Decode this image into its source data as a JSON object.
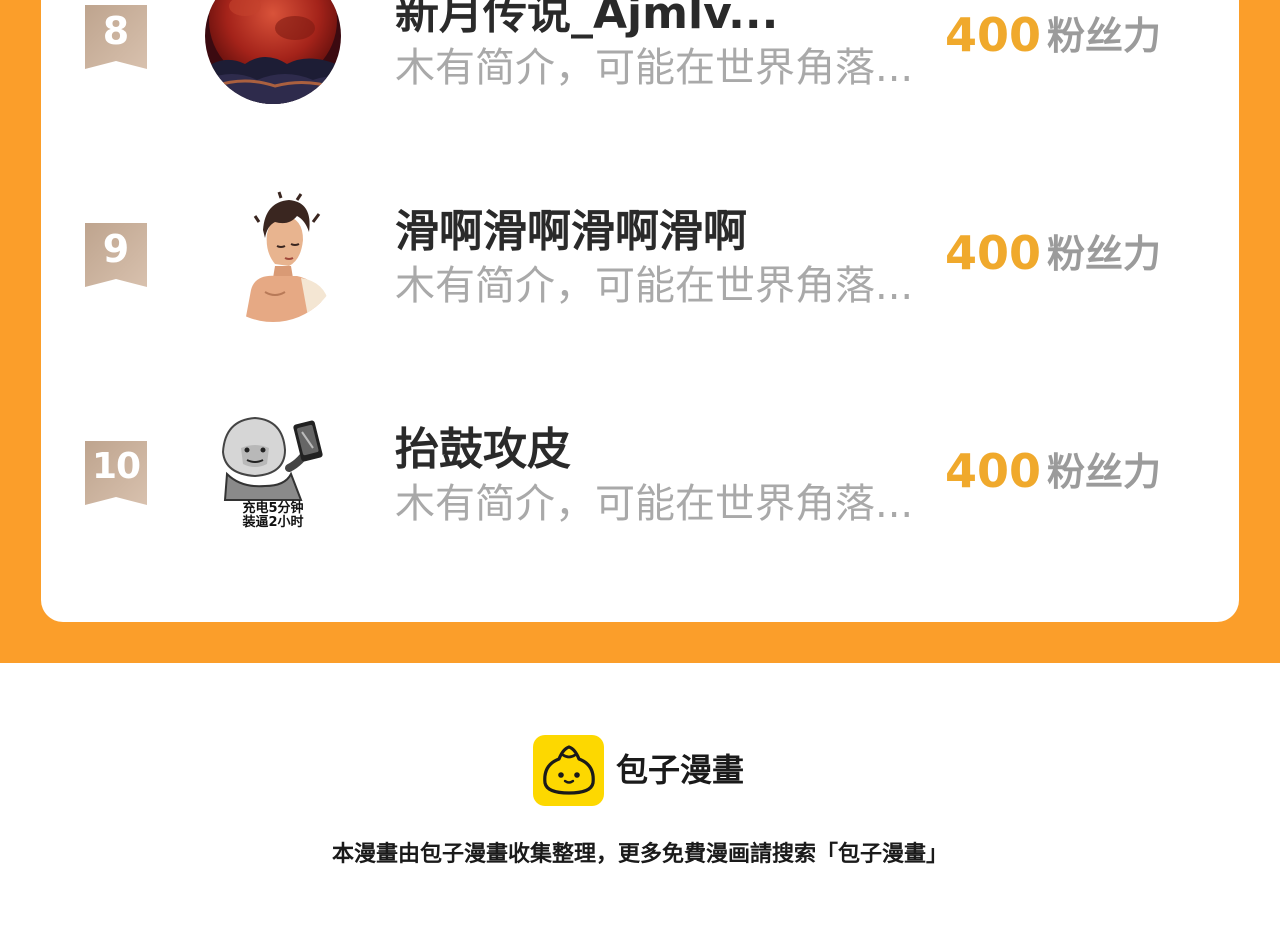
{
  "colors": {
    "accent_orange": "#fb9e2a",
    "fan_count": "#f0a92c",
    "rank_badge": "#c9ab95",
    "logo_yellow": "#fdd800"
  },
  "ranking": {
    "rows": [
      {
        "rank": "8",
        "name": "新月传说_Ajmlv...",
        "bio": "木有简介，可能在世界角落...",
        "fans": "400",
        "fans_unit": "粉丝力",
        "avatar": "blood-moon-avatar"
      },
      {
        "rank": "9",
        "name": "滑啊滑啊滑啊滑啊",
        "bio": "木有简介，可能在世界角落...",
        "fans": "400",
        "fans_unit": "粉丝力",
        "avatar": "anime-boy-avatar"
      },
      {
        "rank": "10",
        "name": "抬鼓攻皮",
        "bio": "木有简介，可能在世界角落...",
        "fans": "400",
        "fans_unit": "粉丝力",
        "avatar": "meme-phone-avatar",
        "avatar_caption_1": "充电5分钟",
        "avatar_caption_2": "装逼2小时"
      }
    ]
  },
  "footer": {
    "brand": "包子漫畫",
    "logo_icon": "bun-logo-icon",
    "note": "本漫畫由包子漫畫收集整理，更多免費漫画請搜索「包子漫畫」"
  }
}
